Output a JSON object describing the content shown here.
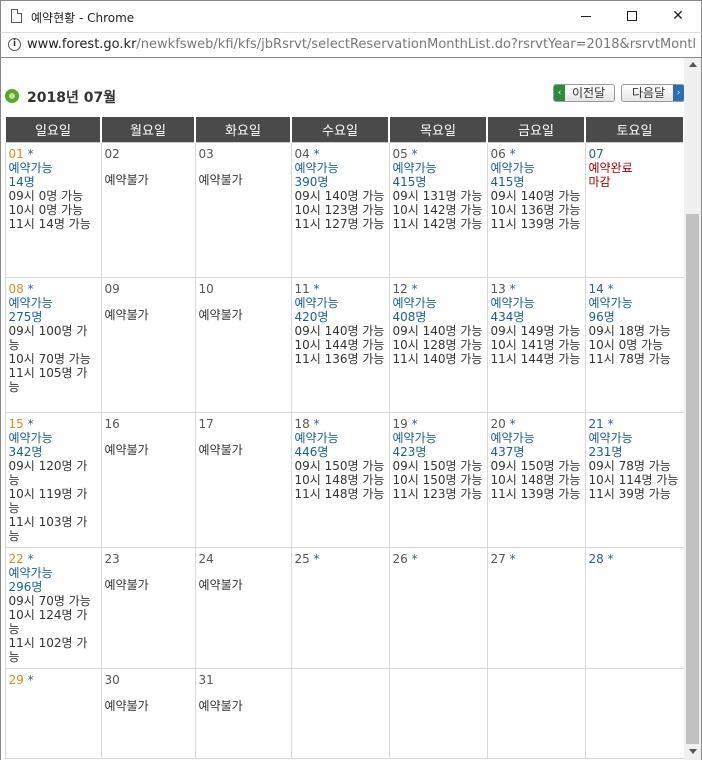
{
  "window": {
    "title": "예약현황 - Chrome",
    "url_host": "www.forest.go.kr",
    "url_path": "/newkfsweb/kfi/kfs/jbRsrvt/selectReservationMonthList.do?rsrvtYear=2018&rsrvtMonth..."
  },
  "calendar": {
    "month_label": "2018년 07월",
    "prev_label": "이전달",
    "next_label": "다음달",
    "weekdays": [
      "일요일",
      "월요일",
      "화요일",
      "수요일",
      "목요일",
      "금요일",
      "토요일"
    ],
    "weeks": [
      [
        {
          "date": "01",
          "star": "*",
          "status": "예약가능",
          "count": "14명",
          "slots": [
            "09시 0명 가능",
            "10시 0명 가능",
            "11시 14명 가능"
          ]
        },
        {
          "date": "02",
          "star": "",
          "closed": "예약불가"
        },
        {
          "date": "03",
          "star": "",
          "closed": "예약불가"
        },
        {
          "date": "04",
          "star": "*",
          "status": "예약가능",
          "count": "390명",
          "slots": [
            "09시 140명 가능",
            "10시 123명 가능",
            "11시 127명 가능"
          ]
        },
        {
          "date": "05",
          "star": "*",
          "status": "예약가능",
          "count": "415명",
          "slots": [
            "09시 131명 가능",
            "10시 142명 가능",
            "11시 142명 가능"
          ]
        },
        {
          "date": "06",
          "star": "*",
          "status": "예약가능",
          "count": "415명",
          "slots": [
            "09시 140명 가능",
            "10시 136명 가능",
            "11시 139명 가능"
          ]
        },
        {
          "date": "07",
          "star": "",
          "full": "예약완료",
          "full2": "마감"
        }
      ],
      [
        {
          "date": "08",
          "star": "*",
          "status": "예약가능",
          "count": "275명",
          "slots": [
            "09시 100명 가능",
            "10시 70명 가능",
            "11시 105명 가능"
          ]
        },
        {
          "date": "09",
          "star": "",
          "closed": "예약불가"
        },
        {
          "date": "10",
          "star": "",
          "closed": "예약불가"
        },
        {
          "date": "11",
          "star": "*",
          "status": "예약가능",
          "count": "420명",
          "slots": [
            "09시 140명 가능",
            "10시 144명 가능",
            "11시 136명 가능"
          ]
        },
        {
          "date": "12",
          "star": "*",
          "status": "예약가능",
          "count": "408명",
          "slots": [
            "09시 140명 가능",
            "10시 128명 가능",
            "11시 140명 가능"
          ]
        },
        {
          "date": "13",
          "star": "*",
          "status": "예약가능",
          "count": "434명",
          "slots": [
            "09시 149명 가능",
            "10시 141명 가능",
            "11시 144명 가능"
          ]
        },
        {
          "date": "14",
          "star": "*",
          "status": "예약가능",
          "count": "96명",
          "slots": [
            "09시 18명 가능",
            "10시 0명 가능",
            "11시 78명 가능"
          ]
        }
      ],
      [
        {
          "date": "15",
          "star": "*",
          "status": "예약가능",
          "count": "342명",
          "slots": [
            "09시 120명 가능",
            "10시 119명 가능",
            "11시 103명 가능"
          ]
        },
        {
          "date": "16",
          "star": "",
          "closed": "예약불가"
        },
        {
          "date": "17",
          "star": "",
          "closed": "예약불가"
        },
        {
          "date": "18",
          "star": "*",
          "status": "예약가능",
          "count": "446명",
          "slots": [
            "09시 150명 가능",
            "10시 148명 가능",
            "11시 148명 가능"
          ]
        },
        {
          "date": "19",
          "star": "*",
          "status": "예약가능",
          "count": "423명",
          "slots": [
            "09시 150명 가능",
            "10시 150명 가능",
            "11시 123명 가능"
          ]
        },
        {
          "date": "20",
          "star": "*",
          "status": "예약가능",
          "count": "437명",
          "slots": [
            "09시 150명 가능",
            "10시 148명 가능",
            "11시 139명 가능"
          ]
        },
        {
          "date": "21",
          "star": "*",
          "status": "예약가능",
          "count": "231명",
          "slots": [
            "09시 78명 가능",
            "10시 114명 가능",
            "11시 39명 가능"
          ]
        }
      ],
      [
        {
          "date": "22",
          "star": "*",
          "status": "예약가능",
          "count": "296명",
          "slots": [
            "09시 70명 가능",
            "10시 124명 가능",
            "11시 102명 가능"
          ]
        },
        {
          "date": "23",
          "star": "",
          "closed": "예약불가"
        },
        {
          "date": "24",
          "star": "",
          "closed": "예약불가"
        },
        {
          "date": "25",
          "star": "*"
        },
        {
          "date": "26",
          "star": "*"
        },
        {
          "date": "27",
          "star": "*"
        },
        {
          "date": "28",
          "star": "*"
        }
      ],
      [
        {
          "date": "29",
          "star": "*"
        },
        {
          "date": "30",
          "star": "",
          "closed": "예약불가"
        },
        {
          "date": "31",
          "star": "",
          "closed": "예약불가"
        },
        {
          "date": "",
          "star": ""
        },
        {
          "date": "",
          "star": ""
        },
        {
          "date": "",
          "star": ""
        },
        {
          "date": "",
          "star": ""
        }
      ]
    ]
  }
}
